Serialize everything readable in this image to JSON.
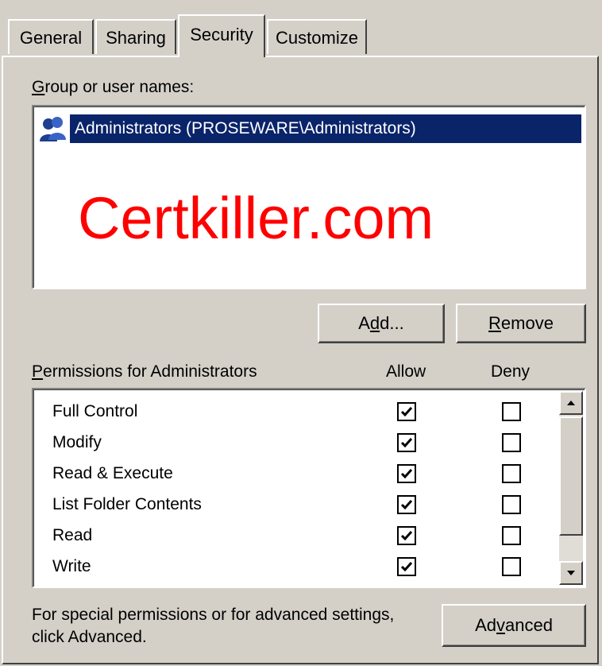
{
  "tabs": [
    {
      "label": "General",
      "active": false
    },
    {
      "label": "Sharing",
      "active": false
    },
    {
      "label": "Security",
      "active": true
    },
    {
      "label": "Customize",
      "active": false
    }
  ],
  "group_label": "Group or user names:",
  "users": [
    {
      "name": "Administrators (PROSEWARE\\Administrators)",
      "selected": true
    }
  ],
  "watermark": "Certkiller.com",
  "buttons": {
    "add": "Add...",
    "remove": "Remove",
    "advanced": "Advanced"
  },
  "permissions": {
    "header": "Permissions for Administrators",
    "allow_header": "Allow",
    "deny_header": "Deny",
    "rows": [
      {
        "name": "Full Control",
        "allow": true,
        "deny": false
      },
      {
        "name": "Modify",
        "allow": true,
        "deny": false
      },
      {
        "name": "Read & Execute",
        "allow": true,
        "deny": false
      },
      {
        "name": "List Folder Contents",
        "allow": true,
        "deny": false
      },
      {
        "name": "Read",
        "allow": true,
        "deny": false
      },
      {
        "name": "Write",
        "allow": true,
        "deny": false
      }
    ]
  },
  "advanced_note": {
    "line1": "For special permissions or for advanced settings,",
    "line2": "click Advanced."
  },
  "colors": {
    "selection": "#0a246a",
    "watermark": "#ff0000",
    "dialog": "#d4d0c8"
  }
}
